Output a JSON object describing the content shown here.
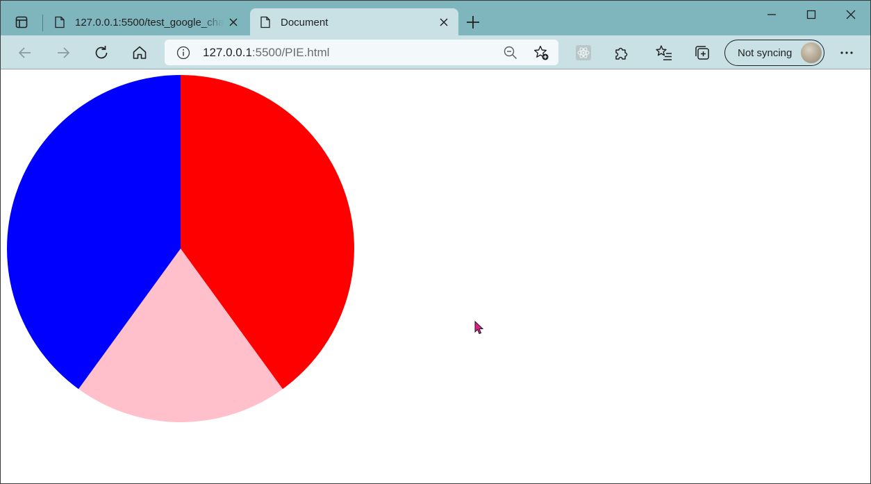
{
  "browser": {
    "tabs": [
      {
        "title": "127.0.0.1:5500/test_google_chart",
        "active": false
      },
      {
        "title": "Document",
        "active": true
      }
    ],
    "address": {
      "host": "127.0.0.1",
      "rest": ":5500/PIE.html"
    },
    "profile_label": "Not syncing"
  },
  "icons": [
    "tab-actions-icon",
    "page-icon",
    "close-icon",
    "plus-icon",
    "minimize-icon",
    "maximize-icon",
    "close-window-icon",
    "back-icon",
    "forward-icon",
    "refresh-icon",
    "home-icon",
    "info-icon",
    "zoom-out-icon",
    "add-favorite-icon",
    "react-extension-icon",
    "extensions-icon",
    "favorites-icon",
    "collections-icon",
    "more-icon"
  ],
  "colors": {
    "titlebar": "#7fb6bd",
    "toolbar": "#c9e1e5",
    "address_bg": "#f3f9fa"
  },
  "chart_data": {
    "type": "pie",
    "start_angle_deg": 0,
    "direction": "clockwise",
    "slices": [
      {
        "value": 40,
        "color": "#ff0000"
      },
      {
        "value": 20,
        "color": "#ffc0cb"
      },
      {
        "value": 40,
        "color": "#0000ff"
      }
    ],
    "title": "",
    "legend": "none"
  }
}
